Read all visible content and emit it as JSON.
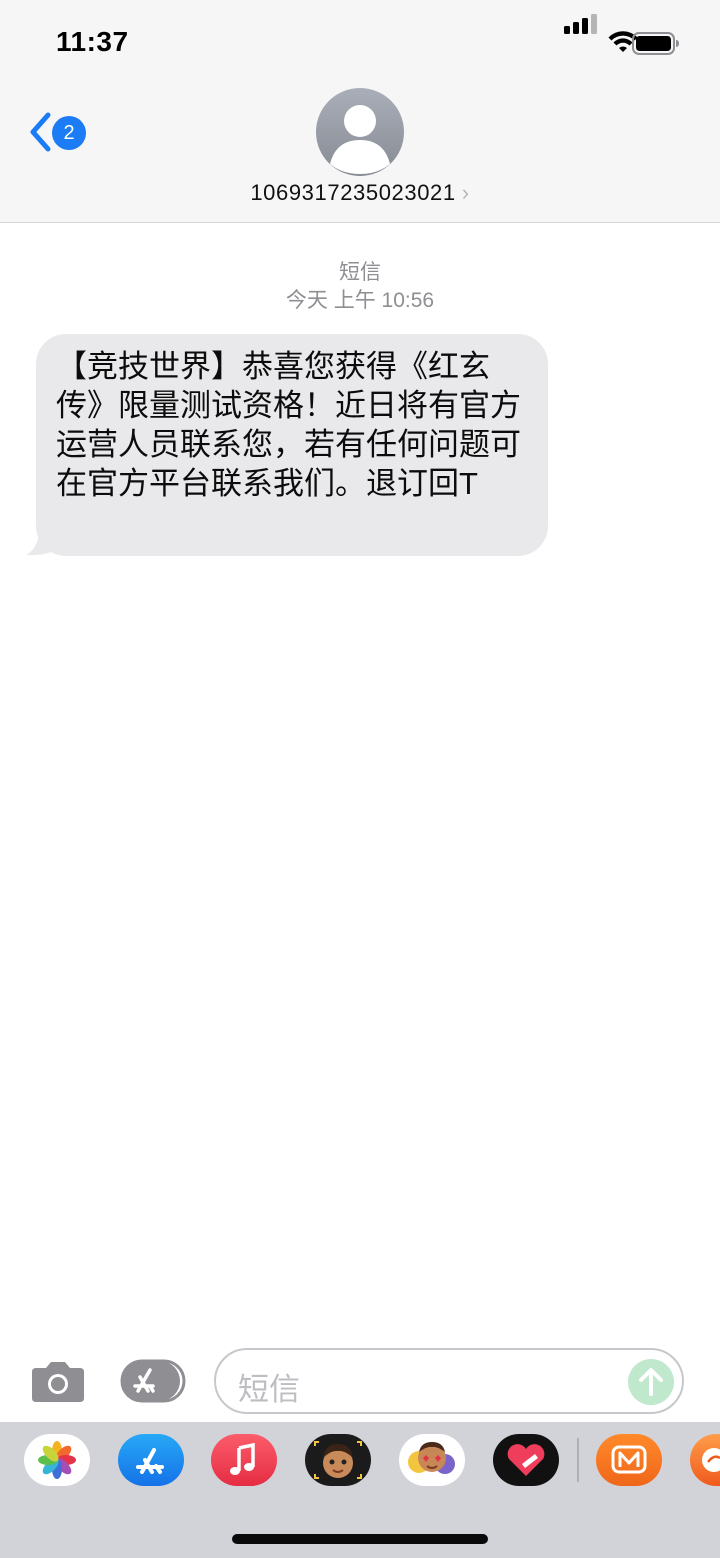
{
  "status_bar": {
    "time": "11:37"
  },
  "nav": {
    "unread_count": "2",
    "contact_number": "1069317235023021",
    "chevron": "›"
  },
  "conversation": {
    "message_type": "短信",
    "timestamp": "今天 上午 10:56",
    "messages": [
      {
        "text": "【竞技世界】恭喜您获得《红玄传》限量测试资格！近日将有官方运营人员联系您，若有任何问题可在官方平台联系我们。退订回T",
        "direction": "incoming"
      }
    ]
  },
  "composer": {
    "placeholder": "短信"
  },
  "app_drawer": {
    "apps": [
      "photos-icon",
      "app-store-icon",
      "music-icon",
      "memoji-icon",
      "animoji-stickers-icon",
      "heart-digital-touch-icon",
      "mango-tv-icon",
      "partial-app-icon"
    ]
  },
  "colors": {
    "accent": "#1b7cf5",
    "bubble": "#e9e9eb",
    "send": "#bfe8cc"
  }
}
